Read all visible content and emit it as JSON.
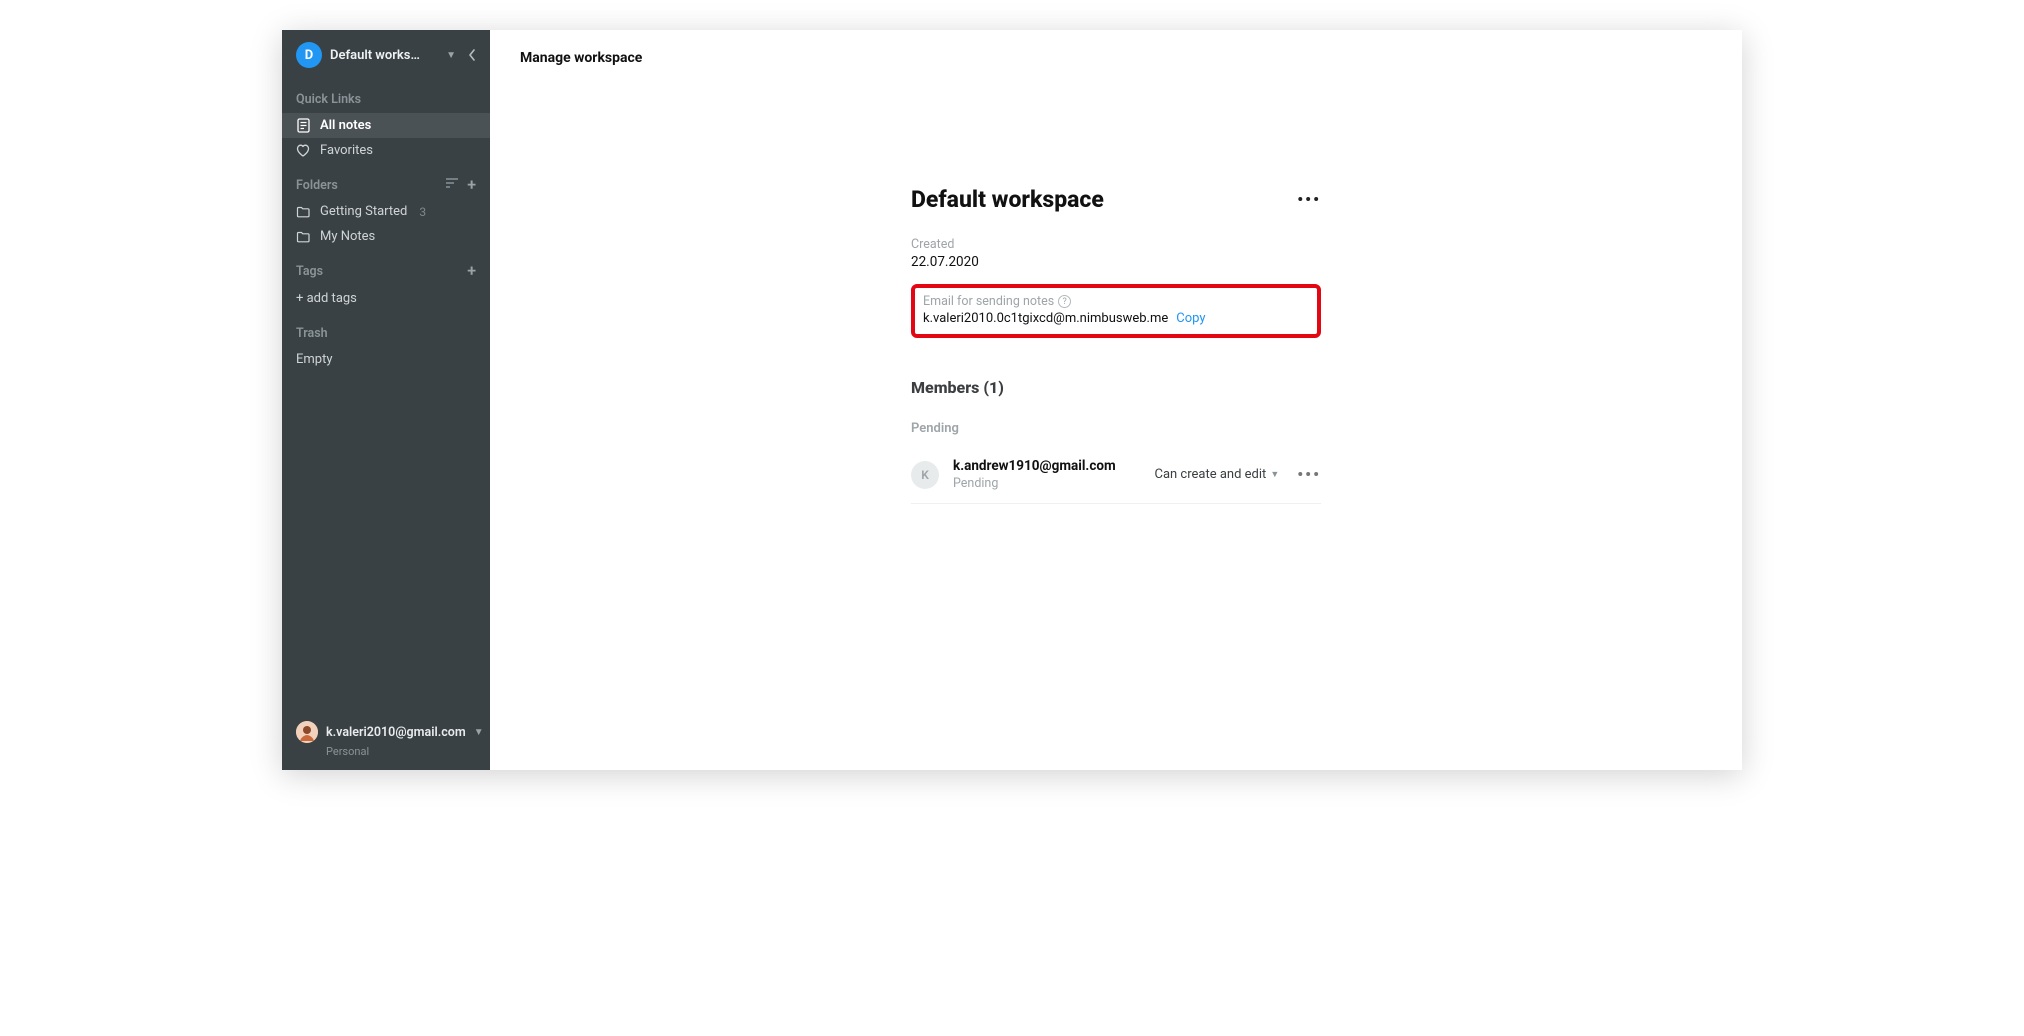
{
  "sidebar": {
    "workspace_avatar_letter": "D",
    "workspace_name": "Default works…",
    "quick_links_heading": "Quick Links",
    "quick_links": {
      "all_notes": "All notes",
      "favorites": "Favorites"
    },
    "folders_heading": "Folders",
    "folders": [
      {
        "label": "Getting Started",
        "count": "3"
      },
      {
        "label": "My Notes",
        "count": ""
      }
    ],
    "tags_heading": "Tags",
    "add_tags_label": "+ add tags",
    "trash_heading": "Trash",
    "trash_empty_label": "Empty",
    "user": {
      "email": "k.valeri2010@gmail.com",
      "plan": "Personal"
    }
  },
  "main": {
    "header_title": "Manage workspace",
    "workspace_title": "Default workspace",
    "created_label": "Created",
    "created_date": "22.07.2020",
    "email_notes_label": "Email for sending notes",
    "email_notes_value": "k.valeri2010.0c1tgixcd@m.nimbusweb.me",
    "copy_label": "Copy",
    "members_heading": "Members (1)",
    "pending_heading": "Pending",
    "members": [
      {
        "avatar_letter": "K",
        "email": "k.andrew1910@gmail.com",
        "status": "Pending",
        "role": "Can create and edit"
      }
    ]
  }
}
